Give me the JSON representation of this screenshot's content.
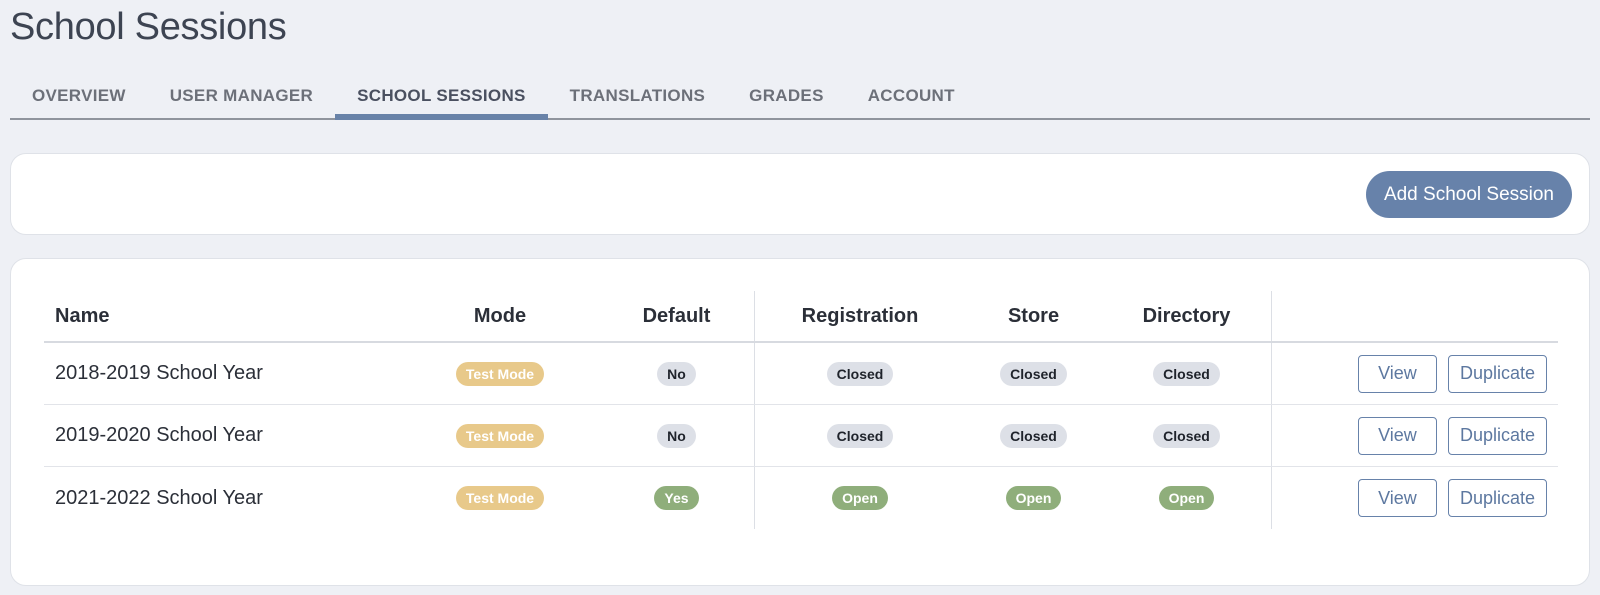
{
  "page": {
    "title": "School Sessions"
  },
  "tabs": [
    {
      "label": "OVERVIEW",
      "active": false
    },
    {
      "label": "USER MANAGER",
      "active": false
    },
    {
      "label": "SCHOOL SESSIONS",
      "active": true
    },
    {
      "label": "TRANSLATIONS",
      "active": false
    },
    {
      "label": "GRADES",
      "active": false
    },
    {
      "label": "ACCOUNT",
      "active": false
    }
  ],
  "toolbar": {
    "add_label": "Add School Session"
  },
  "table": {
    "headers": {
      "name": "Name",
      "mode": "Mode",
      "default": "Default",
      "registration": "Registration",
      "store": "Store",
      "directory": "Directory"
    },
    "rows": [
      {
        "name": "2018-2019 School Year",
        "mode": "Test Mode",
        "default": "No",
        "registration": "Closed",
        "store": "Closed",
        "directory": "Closed",
        "view": "View",
        "duplicate": "Duplicate"
      },
      {
        "name": "2019-2020 School Year",
        "mode": "Test Mode",
        "default": "No",
        "registration": "Closed",
        "store": "Closed",
        "directory": "Closed",
        "view": "View",
        "duplicate": "Duplicate"
      },
      {
        "name": "2021-2022 School Year",
        "mode": "Test Mode",
        "default": "Yes",
        "registration": "Open",
        "store": "Open",
        "directory": "Open",
        "view": "View",
        "duplicate": "Duplicate"
      }
    ]
  },
  "colors": {
    "accent": "#6782aa",
    "test_mode_badge": "#e8c98a",
    "closed_badge": "#dde0e7",
    "open_badge": "#8fae7b"
  }
}
